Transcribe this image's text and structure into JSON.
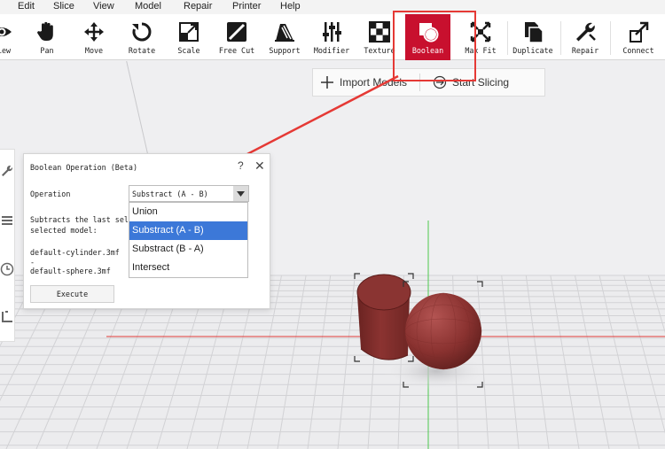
{
  "menu": [
    "Edit",
    "Slice",
    "View",
    "Model",
    "Repair",
    "Printer",
    "Help"
  ],
  "toolbar": {
    "tools": [
      {
        "label": "View",
        "icon": "eye-icon"
      },
      {
        "label": "Pan",
        "icon": "hand-icon"
      },
      {
        "label": "Move",
        "icon": "move-arrows-icon"
      },
      {
        "label": "Rotate",
        "icon": "rotate-icon"
      },
      {
        "label": "Scale",
        "icon": "scale-icon"
      },
      {
        "label": "Free Cut",
        "icon": "cut-icon"
      },
      {
        "label": "Support",
        "icon": "support-icon"
      },
      {
        "label": "Modifier",
        "icon": "sliders-icon"
      },
      {
        "label": "Texture",
        "icon": "checker-icon"
      },
      {
        "label": "Boolean",
        "icon": "boolean-shapes-icon"
      },
      {
        "label": "Max Fit",
        "icon": "max-fit-icon"
      },
      {
        "label": "Duplicate",
        "icon": "duplicate-icon"
      },
      {
        "label": "Repair",
        "icon": "wrench-icon"
      },
      {
        "label": "Connect",
        "icon": "connect-icon"
      }
    ],
    "active": "Boolean",
    "accent_color": "#c8102e"
  },
  "actions": {
    "import_label": "Import Models",
    "slice_label": "Start Slicing"
  },
  "dialog": {
    "title": "Boolean Operation (Beta)",
    "help": "?",
    "close": "✕",
    "operation_label": "Operation",
    "operation_value": "Substract (A - B)",
    "description_line1": "Subtracts the last sel",
    "description_line2": "selected model:",
    "model_a": "default-cylinder.3mf",
    "separator": "-",
    "model_b": "default-sphere.3mf",
    "execute_label": "Execute"
  },
  "dropdown": {
    "options": [
      "Union",
      "Substract (A - B)",
      "Substract (B - A)",
      "Intersect"
    ],
    "selected_index": 1,
    "highlight_color": "#3c78d8"
  },
  "annotation": {
    "color": "#e53935"
  },
  "model_color": "#8a3230"
}
